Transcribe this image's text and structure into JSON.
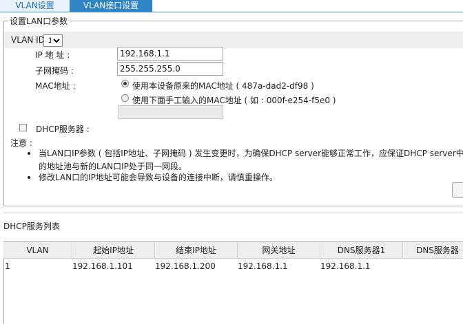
{
  "tabs": [
    {
      "label": "VLAN设置"
    },
    {
      "label": "VLAN接口设置"
    }
  ],
  "form": {
    "legend": "设置LAN口参数",
    "vlan_id_label": "VLAN ID",
    "vlan_id_value": "1",
    "ip_label": "IP 地 址 :",
    "ip_value": "192.168.1.1",
    "mask_label": "子网掩码 :",
    "mask_value": "255.255.255.0",
    "mac_label": "MAC地址 :",
    "mac_option1": "使用本设备原来的MAC地址 ( 487a-dad2-df98 )",
    "mac_option2": "使用下面手工输入的MAC地址 ( 如 : 000f-e254-f5e0 )",
    "mac_custom_value": "",
    "dhcp_label": "DHCP服务器 :",
    "note_label": "注意 :",
    "notes": [
      {
        "line1": "当LAN口IP参数 ( 包括IP地址、子网掩码 ) 发生变更时，为确保DHCP server能够正常工作，应保证DHCP server中设",
        "line2": "的地址池与新的LAN口IP处于同一网段。"
      },
      {
        "line1": "修改LAN口的IP地址可能会导致与设备的连接中断，请慎重操作。"
      }
    ]
  },
  "dhcp_list": {
    "title": "DHCP服务列表",
    "columns": [
      "VLAN",
      "起始IP地址",
      "结束IP地址",
      "网关地址",
      "DNS服务器1",
      "DNS服务器"
    ],
    "rows": [
      [
        "1",
        "192.168.1.101",
        "192.168.1.200",
        "192.168.1.1",
        "192.168.1.1",
        ""
      ]
    ]
  }
}
